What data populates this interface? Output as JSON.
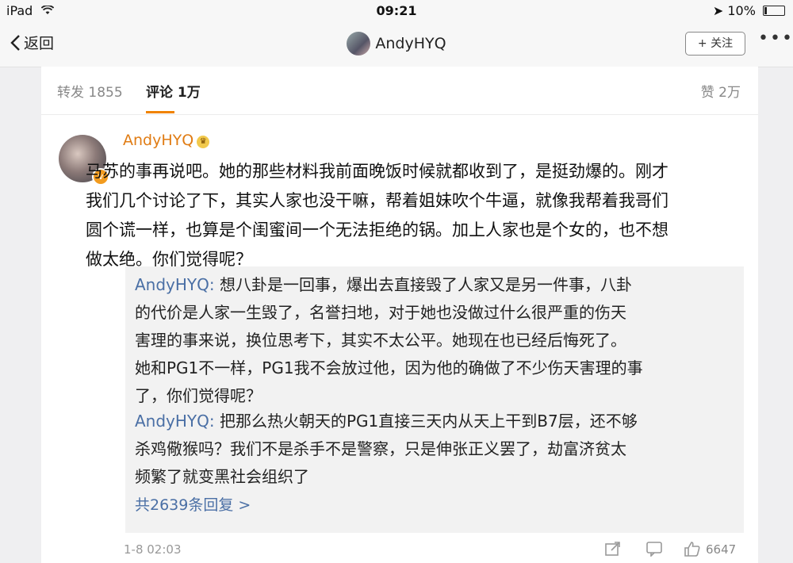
{
  "status_bar": {
    "device": "iPad",
    "time": "09:21",
    "battery": "10%"
  },
  "nav": {
    "back_label": "返回",
    "title": "AndyHYQ",
    "follow_label": "+ 关注",
    "more_label": "•••"
  },
  "tabs": {
    "repost": "转发 1855",
    "comments": "评论 1万",
    "likes": "赞 2万"
  },
  "comment": {
    "author": "AndyHYQ",
    "vip_badge": "vip",
    "lines": [
      "马苏的事再说吧。她的那些材料我前面晚饭时候就都收到了，是挺劲爆的。刚才",
      "我们几个讨论了下，其实人家也没干嘛，帮着姐妹吹个牛逼，就像我帮着我哥们",
      "圆个谎一样，也算是个闺蜜间一个无法拒绝的锅。加上人家也是个女的，也不想",
      "做太绝。你们觉得呢？"
    ],
    "timestamp": "1-8 02:03",
    "like_count": "6647"
  },
  "replies": [
    {
      "name": "AndyHYQ:",
      "lines": [
        " 想八卦是一回事，爆出去直接毁了人家又是另一件事，八卦",
        "的代价是人家一生毁了，名誉扫地，对于她也没做过什么很严重的伤天",
        "害理的事来说，换位思考下，其实不太公平。她现在也已经后悔死了。",
        "她和PG1不一样，PG1我不会放过他，因为他的确做了不少伤天害理的事",
        "了，你们觉得呢？"
      ]
    },
    {
      "name": "AndyHYQ:",
      "lines": [
        " 把那么热火朝天的PG1直接三天内从天上干到B7层，还不够",
        "杀鸡儆猴吗？我们不是杀手不是警察，只是伸张正义罢了，劫富济贫太",
        "频繁了就变黑社会组织了"
      ]
    }
  ],
  "more_replies": "共2639条回复 >",
  "colors": {
    "accent_orange": "#e07c14",
    "link_blue": "#4a6fa5"
  }
}
